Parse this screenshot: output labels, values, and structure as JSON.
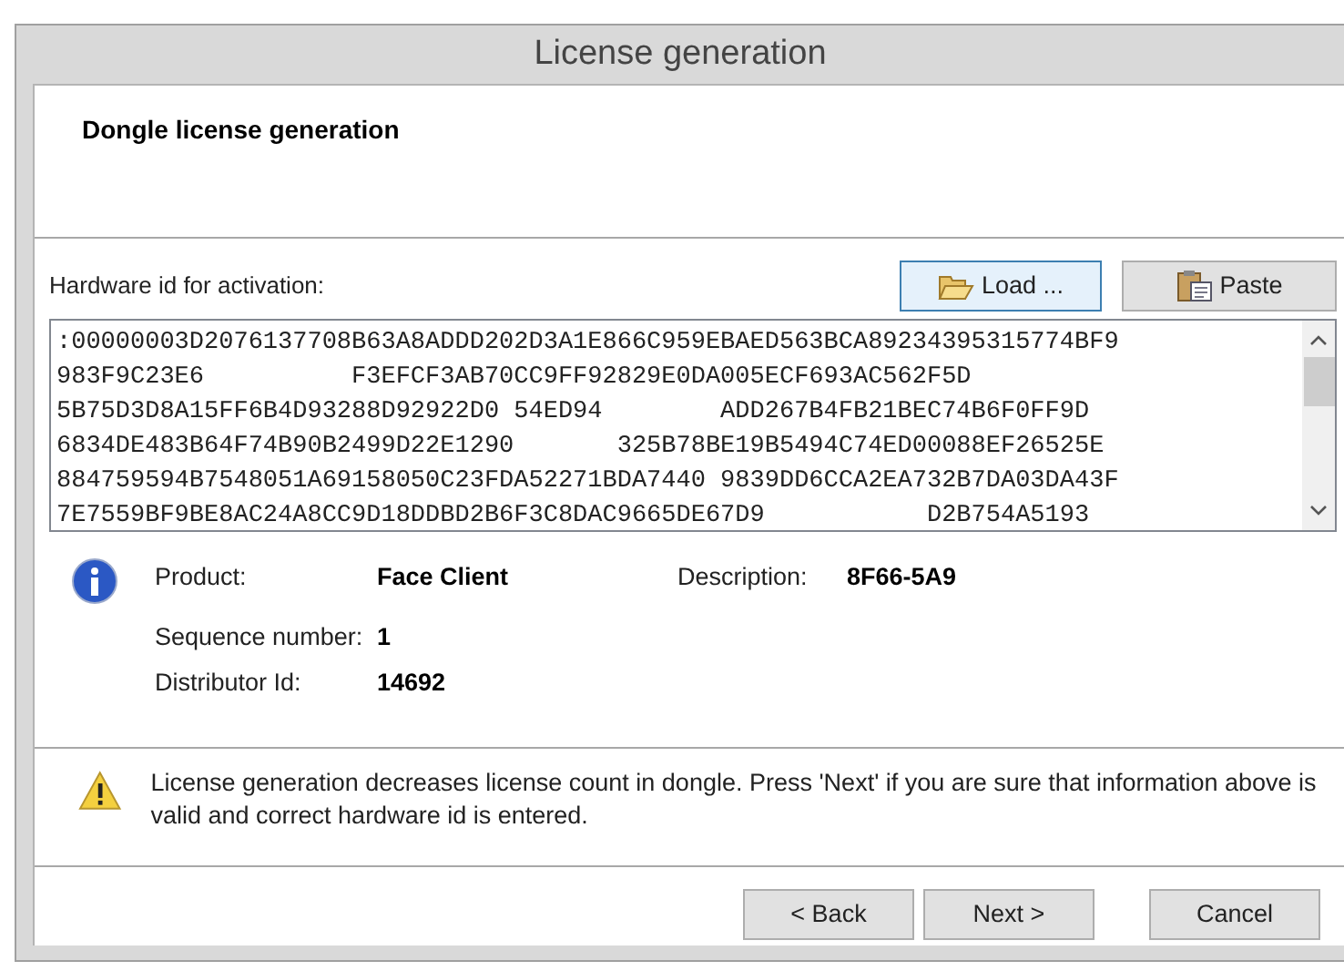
{
  "window": {
    "title": "License generation"
  },
  "header": {
    "title": "Dongle license generation"
  },
  "hardware_id": {
    "label": "Hardware id for activation:",
    "buttons": [
      {
        "label": "Load ...",
        "kind": "load",
        "focused": true
      },
      {
        "label": "Paste",
        "kind": "paste",
        "focused": false
      }
    ],
    "lines": [
      ":00000003D2076137708B63A8ADDD202D3A1E866C959EBAED563BCA89234395315774BF9",
      "983F9C23E6          F3EFCF3AB70CC9FF92829E0DA005ECF693AC562F5D",
      "5B75D3D8A15FF6B4D93288D92922D0 54ED94        ADD267B4FB21BEC74B6F0FF9D",
      "6834DE483B64F74B90B2499D22E1290       325B78BE19B5494C74ED00088EF26525E",
      "884759594B7548051A69158050C23FDA52271BDA7440 9839DD6CCA2EA732B7DA03DA43F",
      "7E7559BF9BE8AC24A8CC9D18DDBD2B6F3C8DAC9665DE67D9           D2B754A5193"
    ]
  },
  "info": {
    "fields": [
      {
        "label": "Product:",
        "value": "Face Client"
      },
      {
        "label": "Sequence number:",
        "value": "1"
      },
      {
        "label": "Distributor Id:",
        "value": "14692"
      }
    ],
    "description": {
      "label": "Description:",
      "value": "8F66-5A9"
    }
  },
  "warning": {
    "text": "License generation decreases license count in dongle. Press 'Next' if you are sure that information above is valid and correct hardware id is entered."
  },
  "footer": {
    "buttons": [
      {
        "label": "< Back",
        "kind": "back"
      },
      {
        "label": "Next >",
        "kind": "next"
      },
      {
        "label": "Cancel",
        "kind": "cancel"
      }
    ]
  }
}
